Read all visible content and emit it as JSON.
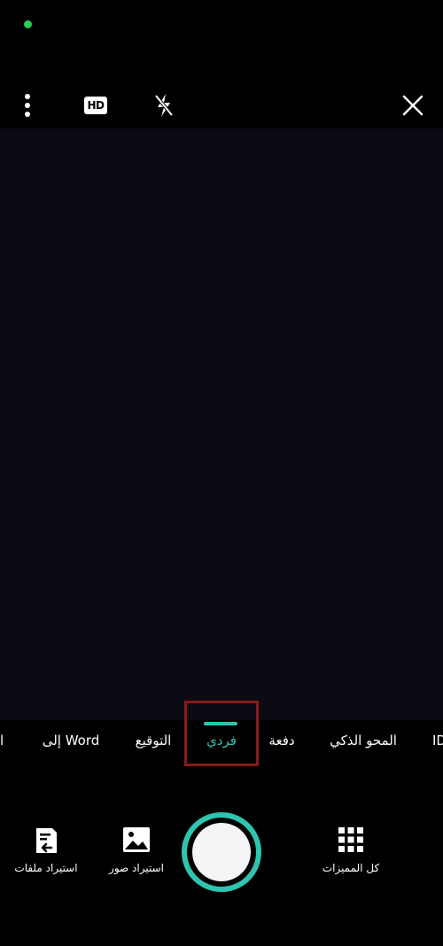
{
  "top_bar": {
    "hd_label": "HD"
  },
  "modes": [
    {
      "label": "إلى Word"
    },
    {
      "label": "التوقيع"
    },
    {
      "label": "فردي"
    },
    {
      "label": "دفعة"
    },
    {
      "label": "المحو الذكي"
    }
  ],
  "mode_edge_left": "ا",
  "mode_edge_right": "ID",
  "bottom": {
    "import_files": "استيراد ملفات",
    "import_photos": "استيراد صور",
    "all_features": "كل المميزات"
  },
  "colors": {
    "accent": "#2fc4b0",
    "highlight": "#8b1a1a",
    "status": "#2ecc52"
  }
}
